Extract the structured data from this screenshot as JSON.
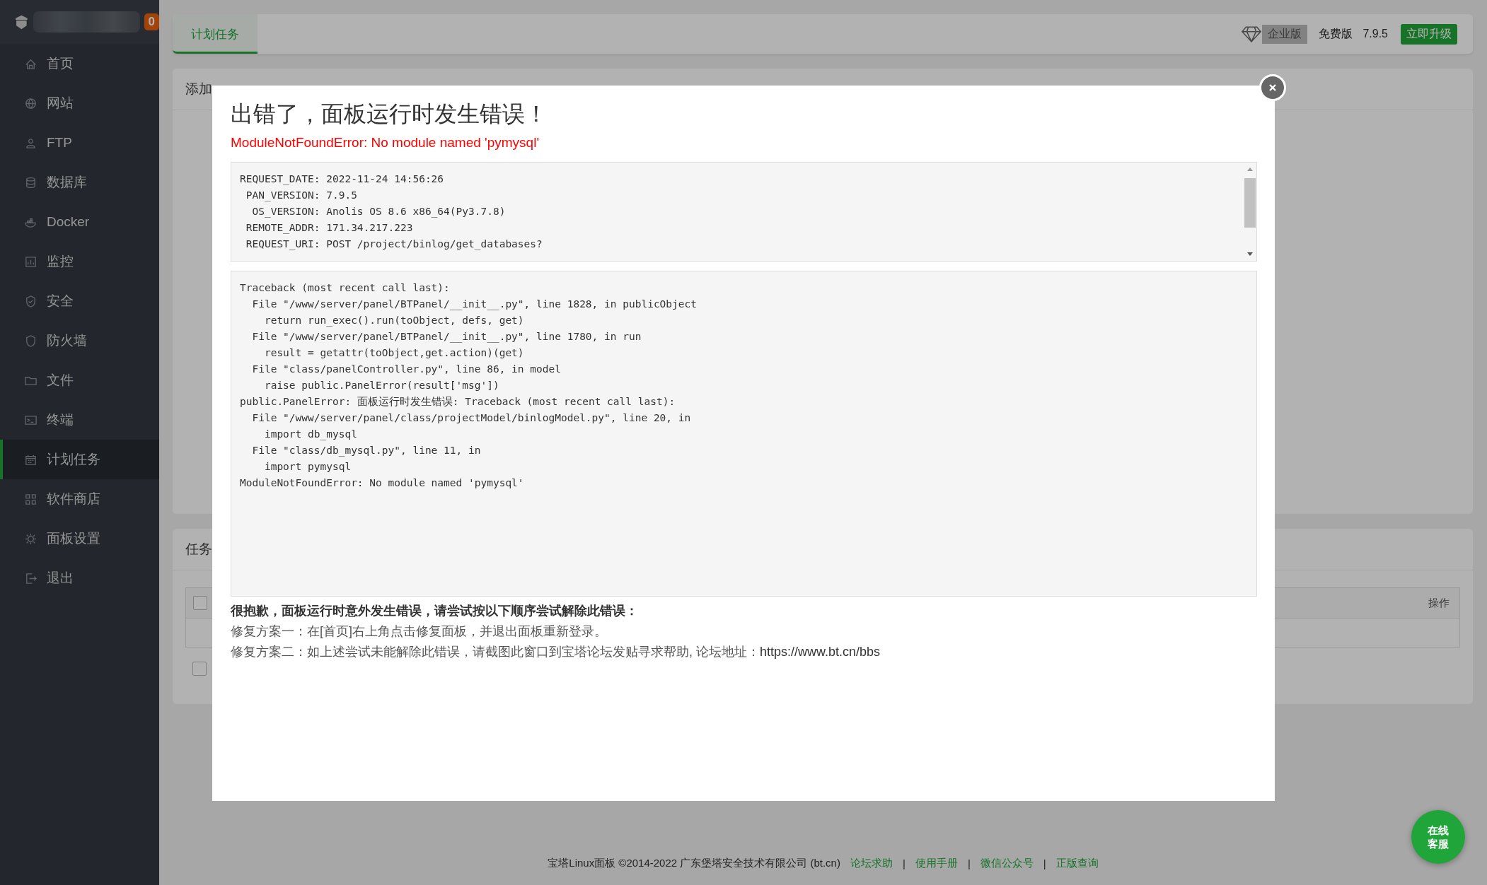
{
  "sidebar": {
    "notification_count": "0",
    "items": [
      {
        "label": "首页",
        "selected": false
      },
      {
        "label": "网站",
        "selected": false
      },
      {
        "label": "FTP",
        "selected": false
      },
      {
        "label": "数据库",
        "selected": false
      },
      {
        "label": "Docker",
        "selected": false
      },
      {
        "label": "监控",
        "selected": false
      },
      {
        "label": "安全",
        "selected": false
      },
      {
        "label": "防火墙",
        "selected": false
      },
      {
        "label": "文件",
        "selected": false
      },
      {
        "label": "终端",
        "selected": false
      },
      {
        "label": "计划任务",
        "selected": true
      },
      {
        "label": "软件商店",
        "selected": false
      },
      {
        "label": "面板设置",
        "selected": false
      },
      {
        "label": "退出",
        "selected": false
      }
    ]
  },
  "topbar": {
    "tabs": [
      {
        "label": "计划任务",
        "selected": true
      }
    ],
    "enterprise_badge": "企业版",
    "edition": "免费版",
    "version": "7.9.5",
    "upgrade_button": "立即升级"
  },
  "add_task_panel": {
    "title": "添加"
  },
  "task_list_panel": {
    "title": "任务",
    "table": {
      "columns": [
        {
          "kind": "checkbox",
          "checked": false
        },
        {
          "kind": "text",
          "label": "操作"
        }
      ]
    },
    "select_all": {
      "checked": false
    }
  },
  "error_dialog": {
    "title": "出错了，面板运行时发生错误！",
    "error_summary": "ModuleNotFoundError: No module named 'pymysql'",
    "request_info": [
      "REQUEST_DATE: 2022-11-24 14:56:26",
      " PAN_VERSION: 7.9.5",
      "  OS_VERSION: Anolis OS 8.6 x86_64(Py3.7.8)",
      " REMOTE_ADDR: 171.34.217.223",
      " REQUEST_URI: POST /project/binlog/get_databases?"
    ],
    "traceback": [
      "Traceback (most recent call last):",
      "  File \"/www/server/panel/BTPanel/__init__.py\", line 1828, in publicObject",
      "    return run_exec().run(toObject, defs, get)",
      "  File \"/www/server/panel/BTPanel/__init__.py\", line 1780, in run",
      "    result = getattr(toObject,get.action)(get)",
      "  File \"class/panelController.py\", line 86, in model",
      "    raise public.PanelError(result['msg'])",
      "public.PanelError: 面板运行时发生错误: Traceback (most recent call last):",
      "  File \"/www/server/panel/class/projectModel/binlogModel.py\", line 20, in",
      "    import db_mysql",
      "  File \"class/db_mysql.py\", line 11, in",
      "    import pymysql",
      "ModuleNotFoundError: No module named 'pymysql'"
    ],
    "help_heading": "很抱歉，面板运行时意外发生错误，请尝试按以下顺序尝试解除此错误：",
    "help_lines": [
      {
        "text": "修复方案一：在[首页]右上角点击修复面板，并退出面板重新登录。"
      },
      {
        "text": "修复方案二：如上述尝试未能解除此错误，请截图此窗口到宝塔论坛发贴寻求帮助, 论坛地址：",
        "link": "https://www.bt.cn/bbs"
      }
    ]
  },
  "footer": {
    "copyright": "宝塔Linux面板 ©2014-2022 广东堡塔安全技术有限公司 (bt.cn)",
    "items": [
      {
        "kind": "link",
        "text": "论坛求助"
      },
      {
        "kind": "separator",
        "text": "|"
      },
      {
        "kind": "link",
        "text": "使用手册"
      },
      {
        "kind": "separator",
        "text": "|"
      },
      {
        "kind": "link",
        "text": "微信公众号"
      },
      {
        "kind": "separator",
        "text": "|"
      },
      {
        "kind": "link",
        "text": "正版查询"
      }
    ]
  },
  "chat_button": "在线客服"
}
